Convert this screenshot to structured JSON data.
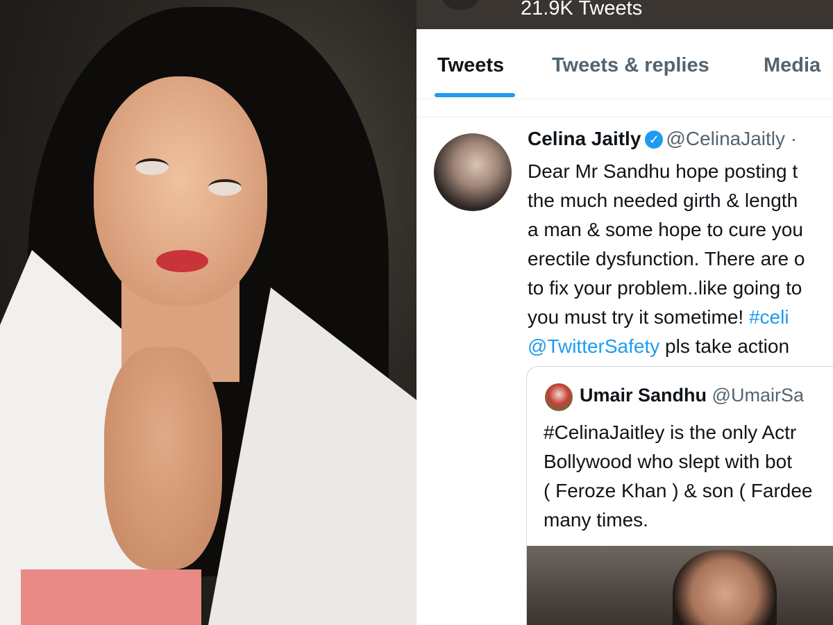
{
  "profile": {
    "tweet_count": "21.9K Tweets"
  },
  "tabs": [
    {
      "label": "Tweets",
      "active": true
    },
    {
      "label": "Tweets & replies",
      "active": false
    },
    {
      "label": "Media",
      "active": false
    }
  ],
  "tweet": {
    "author_name": "Celina Jaitly",
    "author_handle": "@CelinaJaitly ·",
    "lines": [
      "Dear Mr Sandhu hope posting t",
      "the much needed girth & length",
      "a man & some hope to cure you",
      "erectile dysfunction. There are o",
      "to fix your problem..like going to",
      "you must try it sometime! "
    ],
    "hashtag": "#celi",
    "mention": "@TwitterSafety",
    "last_line_rest": " pls take action",
    "quoted": {
      "author_name": "Umair Sandhu",
      "author_handle": "@UmairSa",
      "lines": [
        "#CelinaJaitley is the only Actr",
        "Bollywood who slept with bot",
        "( Feroze Khan ) & son ( Fardee",
        "many times."
      ]
    }
  },
  "colors": {
    "accent": "#1d9bf0",
    "text": "#0f1419",
    "muted": "#536471"
  }
}
